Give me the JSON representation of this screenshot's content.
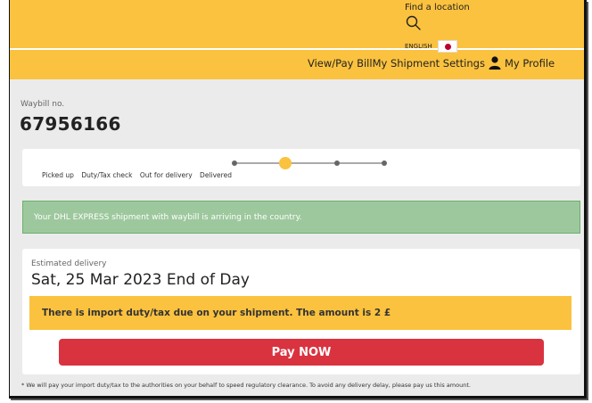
{
  "header": {
    "find_location": "Find a location",
    "language": "ENGLISH",
    "nav": {
      "pay_bill": "View/Pay Bill",
      "shipment_settings": "My Shipment Settings",
      "profile": "My Profile"
    }
  },
  "shipment": {
    "waybill_label": "Waybill no.",
    "waybill_number": "67956166"
  },
  "progress": {
    "steps": [
      "Picked up",
      "Duty/Tax check",
      "Out for delivery",
      "Delivered"
    ],
    "current_step_index": 1
  },
  "alert": {
    "message": "Your DHL EXPRESS shipment with waybill is arriving in the country."
  },
  "delivery": {
    "estimated_label": "Estimated delivery",
    "date": "Sat, 25 Mar 2023 End of Day",
    "duty_notice": "There is import duty/tax due on your shipment. The amount is 2 £",
    "pay_button": "Pay NOW"
  },
  "footnote": "* We will pay your import duty/tax to the authorities on your behalf to speed regulatory clearance. To avoid any delivery delay, please pay us this amount.",
  "colors": {
    "brand_yellow": "#fbc23f",
    "pay_red": "#d9333f",
    "success_green": "#9dc89d"
  }
}
